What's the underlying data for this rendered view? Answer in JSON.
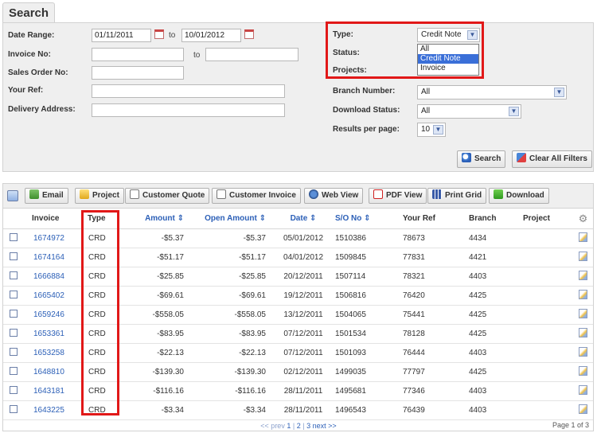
{
  "search": {
    "title": "Search",
    "date_range_label": "Date Range:",
    "date_from": "01/11/2011",
    "date_to": "10/01/2012",
    "to_label": "to",
    "invoice_no_label": "Invoice No:",
    "invoice_to_label": "to",
    "sales_order_label": "Sales Order No:",
    "your_ref_label": "Your Ref:",
    "delivery_address_label": "Delivery Address:",
    "type_label": "Type:",
    "type_value": "Credit Note",
    "type_options": [
      "All",
      "Credit Note",
      "Invoice"
    ],
    "status_label": "Status:",
    "projects_label": "Projects:",
    "branch_label": "Branch Number:",
    "branch_value": "All",
    "download_status_label": "Download Status:",
    "download_status_value": "All",
    "results_label": "Results per page:",
    "results_value": "10",
    "search_button": "Search",
    "clear_button": "Clear All Filters"
  },
  "toolbar": {
    "email": "Email",
    "project": "Project",
    "customer_quote": "Customer Quote",
    "customer_invoice": "Customer Invoice",
    "web_view": "Web View",
    "pdf_view": "PDF View",
    "print_grid": "Print Grid",
    "download": "Download"
  },
  "grid": {
    "columns": {
      "invoice": "Invoice",
      "type": "Type",
      "amount": "Amount ⇕",
      "open_amount": "Open Amount ⇕",
      "date": "Date ⇕",
      "so_no": "S/O No ⇕",
      "your_ref": "Your Ref",
      "branch": "Branch",
      "project": "Project"
    },
    "rows": [
      {
        "invoice": "1674972",
        "type": "CRD",
        "amount": "-$5.37",
        "open": "-$5.37",
        "date": "05/01/2012",
        "so": "1510386",
        "ref": "78673",
        "branch": "4434",
        "project": ""
      },
      {
        "invoice": "1674164",
        "type": "CRD",
        "amount": "-$51.17",
        "open": "-$51.17",
        "date": "04/01/2012",
        "so": "1509845",
        "ref": "77831",
        "branch": "4421",
        "project": ""
      },
      {
        "invoice": "1666884",
        "type": "CRD",
        "amount": "-$25.85",
        "open": "-$25.85",
        "date": "20/12/2011",
        "so": "1507114",
        "ref": "78321",
        "branch": "4403",
        "project": ""
      },
      {
        "invoice": "1665402",
        "type": "CRD",
        "amount": "-$69.61",
        "open": "-$69.61",
        "date": "19/12/2011",
        "so": "1506816",
        "ref": "76420",
        "branch": "4425",
        "project": ""
      },
      {
        "invoice": "1659246",
        "type": "CRD",
        "amount": "-$558.05",
        "open": "-$558.05",
        "date": "13/12/2011",
        "so": "1504065",
        "ref": "75441",
        "branch": "4425",
        "project": ""
      },
      {
        "invoice": "1653361",
        "type": "CRD",
        "amount": "-$83.95",
        "open": "-$83.95",
        "date": "07/12/2011",
        "so": "1501534",
        "ref": "78128",
        "branch": "4425",
        "project": ""
      },
      {
        "invoice": "1653258",
        "type": "CRD",
        "amount": "-$22.13",
        "open": "-$22.13",
        "date": "07/12/2011",
        "so": "1501093",
        "ref": "76444",
        "branch": "4403",
        "project": ""
      },
      {
        "invoice": "1648810",
        "type": "CRD",
        "amount": "-$139.30",
        "open": "-$139.30",
        "date": "02/12/2011",
        "so": "1499035",
        "ref": "77797",
        "branch": "4425",
        "project": ""
      },
      {
        "invoice": "1643181",
        "type": "CRD",
        "amount": "-$116.16",
        "open": "-$116.16",
        "date": "28/11/2011",
        "so": "1495681",
        "ref": "77346",
        "branch": "4403",
        "project": ""
      },
      {
        "invoice": "1643225",
        "type": "CRD",
        "amount": "-$3.34",
        "open": "-$3.34",
        "date": "28/11/2011",
        "so": "1496543",
        "ref": "76439",
        "branch": "4403",
        "project": ""
      }
    ]
  },
  "pager": {
    "prev": "<< prev",
    "pages": [
      "1",
      "2",
      "3"
    ],
    "sep": "|",
    "next": "next >>",
    "page_of": "Page 1 of 3"
  },
  "icons": [
    "calendar-icon",
    "dropdown-arrow-icon",
    "search-icon",
    "clear-filter-icon",
    "email-icon",
    "project-icon",
    "quote-icon",
    "invoice-icon",
    "web-view-icon",
    "pdf-icon",
    "print-grid-icon",
    "download-icon",
    "settings-gear-icon",
    "edit-row-icon",
    "select-all-icon"
  ],
  "colors": {
    "highlight_box": "#e11818",
    "link": "#2b5fb7",
    "selected_option": "#3a6fd8",
    "panel_bg": "#efefef"
  }
}
